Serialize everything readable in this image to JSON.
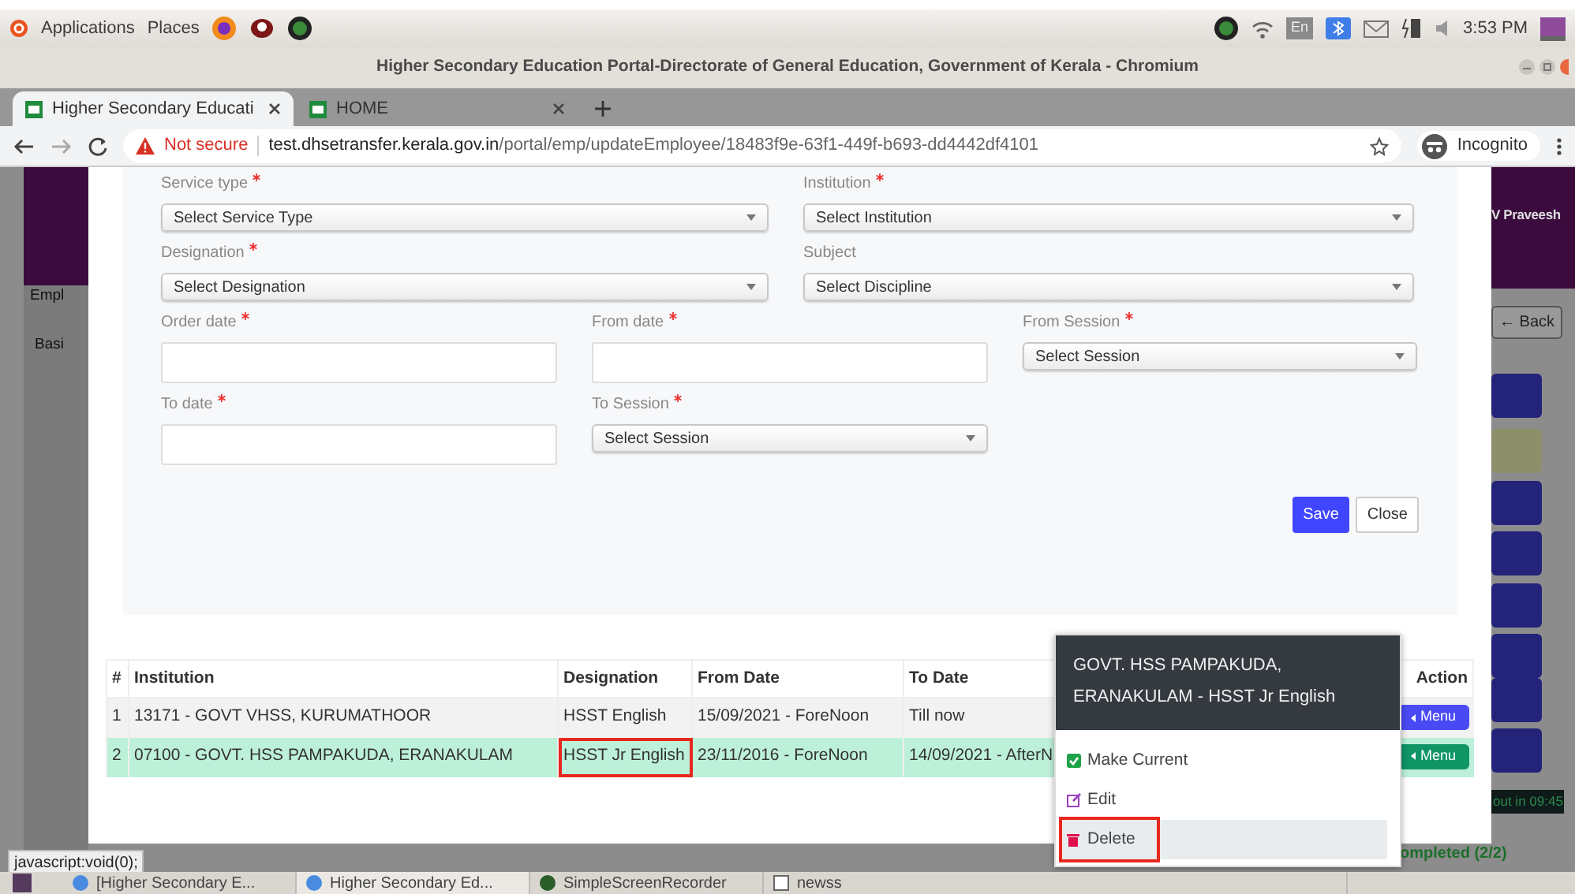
{
  "system_bar": {
    "menus": [
      "Applications",
      "Places"
    ],
    "keyboard": "En",
    "clock": "3:53 PM"
  },
  "window": {
    "title": "Higher Secondary Education Portal-Directorate of General Education, Government of Kerala - Chromium"
  },
  "tabs": [
    {
      "title": "Higher Secondary Educati",
      "selected": true
    },
    {
      "title": "HOME",
      "selected": false
    }
  ],
  "address_bar": {
    "security": "Not secure",
    "host": "test.dhsetransfer.kerala.gov.in",
    "path": "/portal/emp/updateEmployee/18483f9e-63f1-449f-b693-dd4442df4101",
    "profile": "Incognito"
  },
  "background_page": {
    "user": "V Praveesh",
    "back": "← Back",
    "labels": [
      "Empl",
      "Basi"
    ],
    "timer": "out in 09:45",
    "progress": "ompleted (2/2)"
  },
  "form": {
    "rows": [
      [
        {
          "label": "Service type",
          "required": true,
          "kind": "select",
          "placeholder": "Select Service Type"
        },
        {
          "label": "Institution",
          "required": true,
          "kind": "select",
          "placeholder": "Select Institution"
        }
      ],
      [
        {
          "label": "Designation",
          "required": true,
          "kind": "select",
          "placeholder": "Select Designation"
        },
        {
          "label": "Subject",
          "required": false,
          "kind": "select",
          "placeholder": "Select Discipline"
        }
      ],
      [
        {
          "label": "Order date",
          "required": true,
          "kind": "date"
        },
        {
          "label": "From date",
          "required": true,
          "kind": "date"
        },
        {
          "label": "From Session",
          "required": true,
          "kind": "select",
          "placeholder": "Select Session"
        }
      ],
      [
        {
          "label": "To date",
          "required": true,
          "kind": "date"
        },
        {
          "label": "To Session",
          "required": true,
          "kind": "select",
          "placeholder": "Select Session"
        }
      ]
    ],
    "buttons": [
      "Save",
      "Close"
    ]
  },
  "table": {
    "columns": [
      "#",
      "Institution",
      "Designation",
      "From Date",
      "To Date",
      "Action"
    ],
    "rows": [
      {
        "number": "1",
        "institution": "13171 - GOVT VHSS, KURUMATHOOR",
        "designation": "HSST English",
        "designation_boxed": false,
        "from_date": "15/09/2021 - ForeNoon",
        "to_date": "Till now",
        "action": "Menu",
        "selected": false
      },
      {
        "number": "2",
        "institution": "07100 - GOVT. HSS PAMPAKUDA, ERANAKULAM",
        "designation": "HSST Jr English",
        "designation_boxed": true,
        "from_date": "23/11/2016 - ForeNoon",
        "to_date": "14/09/2021 - AfterN",
        "action": "Menu",
        "selected": true
      }
    ]
  },
  "menu": {
    "header": "GOVT. HSS PAMPAKUDA, ERANAKULAM - HSST Jr English",
    "items": [
      {
        "label": "Make Current",
        "kind": "check",
        "selected": false,
        "boxed": false
      },
      {
        "label": "Edit",
        "kind": "edit",
        "selected": false,
        "boxed": false
      },
      {
        "label": "Delete",
        "kind": "delete",
        "selected": true,
        "boxed": true
      }
    ]
  },
  "status_tooltip": "javascript:void(0);",
  "taskbar": [
    {
      "title": "[Higher Secondary E...",
      "selected": false
    },
    {
      "title": "Higher Secondary Ed...",
      "selected": true
    },
    {
      "title": "SimpleScreenRecorder",
      "selected": false
    },
    {
      "title": "newss",
      "selected": false
    }
  ]
}
